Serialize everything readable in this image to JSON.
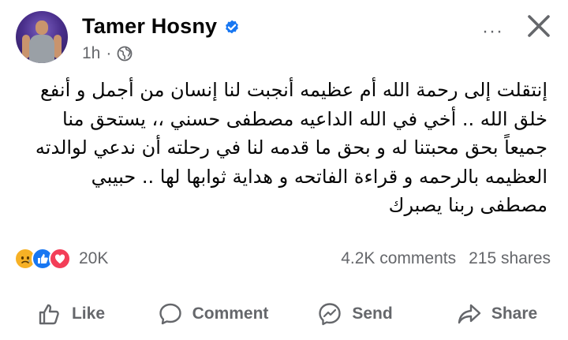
{
  "header": {
    "author_name": "Tamer Hosny",
    "timestamp": "1h",
    "more_icon_label": "···"
  },
  "post": {
    "text": "إنتقلت إلى رحمة الله أم عظيمه أنجبت لنا إنسان من أجمل و أنفع\nخلق الله .. أخي في الله الداعيه مصطفى حسني ،، يستحق منا\nجميعاً بحق محبتنا له و بحق ما قدمه لنا في رحلته أن ندعي لوالدته\nالعظيمه بالرحمه و قراءة الفاتحه و هداية ثوابها لها .. حبيبي\nمصطفى ربنا يصبرك"
  },
  "stats": {
    "reactions_count": "20K",
    "comments": "4.2K comments",
    "shares": "215 shares"
  },
  "actions": {
    "like": "Like",
    "comment": "Comment",
    "send": "Send",
    "share": "Share"
  },
  "icons": [
    "verified-badge-icon",
    "globe-icon",
    "close-icon",
    "sad-reaction-icon",
    "like-reaction-icon",
    "love-reaction-icon",
    "thumbs-up-icon",
    "comment-bubble-icon",
    "messenger-send-icon",
    "share-arrow-icon"
  ],
  "colors": {
    "brand_blue": "#1877f2",
    "secondary_text": "#65676b",
    "love": "#f33e58",
    "sad": "#f7b125"
  }
}
